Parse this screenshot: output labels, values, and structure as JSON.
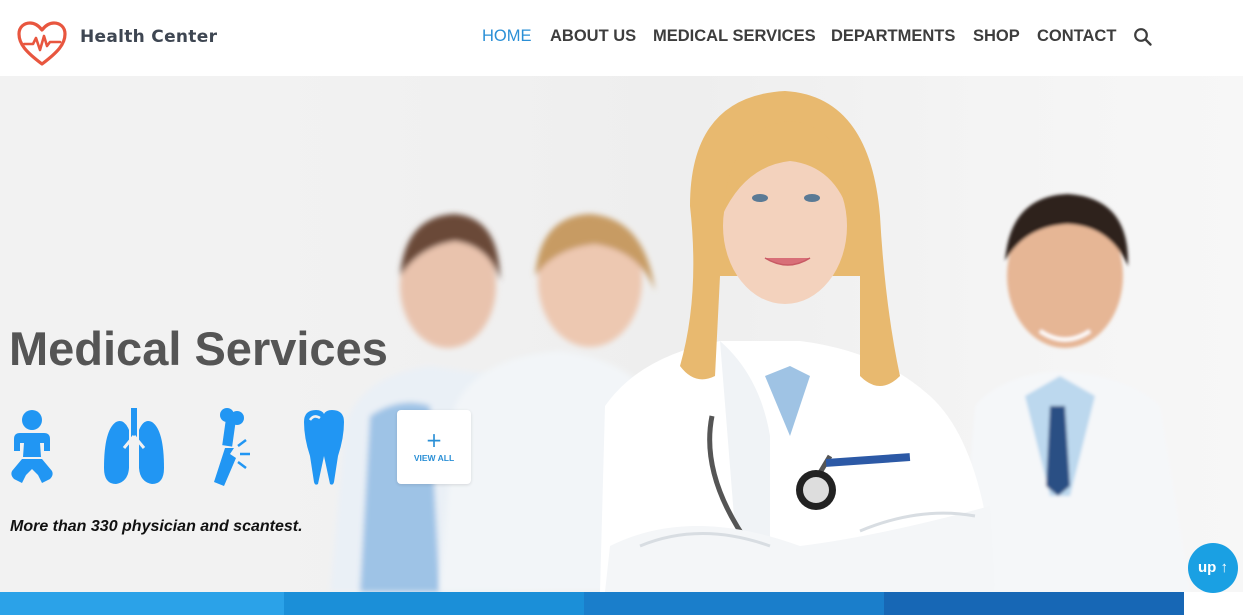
{
  "brand": {
    "name": "Health Center",
    "logo_icon": "heart-pulse-icon"
  },
  "nav": {
    "items": [
      {
        "label": "HOME",
        "active": true
      },
      {
        "label": "ABOUT US",
        "active": false
      },
      {
        "label": "MEDICAL SERVICES",
        "active": false
      },
      {
        "label": "DEPARTMENTS",
        "active": false
      },
      {
        "label": "SHOP",
        "active": false
      },
      {
        "label": "CONTACT",
        "active": false
      }
    ],
    "search_icon": "search-icon"
  },
  "hero": {
    "title": "Medical Services",
    "subtitle": "More than 330 physician and scantest.",
    "services": [
      {
        "icon": "baby-icon"
      },
      {
        "icon": "lungs-icon"
      },
      {
        "icon": "broken-bone-icon"
      },
      {
        "icon": "tooth-icon"
      }
    ],
    "view_all": {
      "plus": "+",
      "label": "VIEW ALL"
    }
  },
  "scroll_top": {
    "label": "up",
    "arrow": "↑"
  },
  "colors": {
    "accent": "#2a8fd6",
    "icon_blue": "#2196f3",
    "logo_red": "#e8563f",
    "nav_text": "#3d3d3d",
    "title_gray": "#555555",
    "up_button": "#1aa0e3",
    "bottom_bars": [
      "#2ba2e8",
      "#1b8fd8",
      "#1a7ecb",
      "#1767b5"
    ]
  }
}
